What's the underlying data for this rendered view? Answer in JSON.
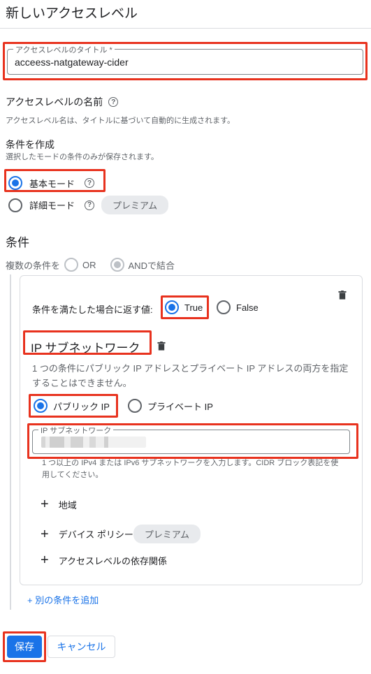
{
  "header": {
    "title": "新しいアクセスレベル"
  },
  "title_field": {
    "label": "アクセスレベルのタイトル *",
    "value": "acceess-natgateway-cider"
  },
  "name_section": {
    "heading": "アクセスレベルの名前",
    "description": "アクセスレベル名は、タイトルに基づいて自動的に生成されます。"
  },
  "create_condition": {
    "heading": "条件を作成",
    "description": "選択したモードの条件のみが保存されます。",
    "basic_mode": "基本モード",
    "advanced_mode": "詳細モード",
    "premium_badge": "プレミアム"
  },
  "conditions": {
    "heading": "条件",
    "combine_label": "複数の条件を",
    "or_label": "OR",
    "and_label": "ANDで結合"
  },
  "condition_card": {
    "return_label": "条件を満たした場合に返す値:",
    "true_label": "True",
    "false_label": "False",
    "ip_heading": "IP サブネットワーク",
    "ip_note": "1 つの条件にパブリック IP アドレスとプライベート IP アドレスの両方を指定することはできません。",
    "public_ip": "パブリック IP",
    "private_ip": "プライベート IP",
    "subnet_field_label": "IP サブネットワーク",
    "subnet_help": "1 つ以上の IPv4 または IPv6 サブネットワークを入力します。CIDR ブロック表記を使用してください。",
    "add_region": "地域",
    "add_device_policy": "デバイス ポリシー",
    "device_premium": "プレミアム",
    "add_dependency": "アクセスレベルの依存関係"
  },
  "add_condition_link": "+ 別の条件を追加",
  "actions": {
    "save": "保存",
    "cancel": "キャンセル"
  },
  "colors": {
    "accent": "#1a73e8",
    "highlight": "#e8321e"
  }
}
